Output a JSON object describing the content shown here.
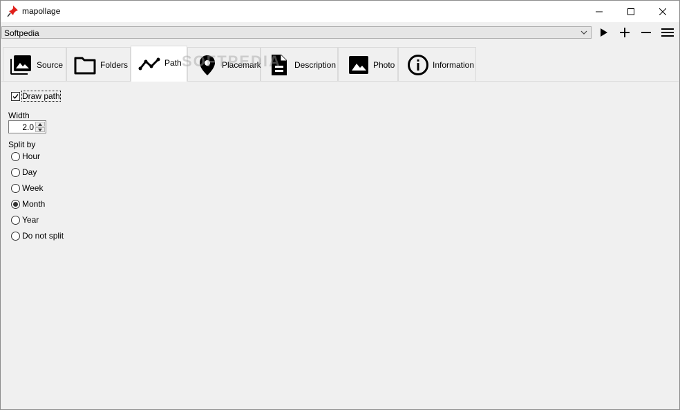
{
  "app": {
    "title": "mapollage"
  },
  "window_controls": {
    "minimize_icon": "minimize-icon",
    "maximize_icon": "maximize-icon",
    "close_icon": "close-icon"
  },
  "toolbar": {
    "profile_value": "Softpedia",
    "buttons": [
      "play-icon",
      "plus-icon",
      "minus-icon",
      "menu-icon"
    ]
  },
  "tabs": [
    {
      "label": "Source",
      "icon": "source-images-icon"
    },
    {
      "label": "Folders",
      "icon": "folder-icon"
    },
    {
      "label": "Path",
      "icon": "path-line-icon",
      "active": true
    },
    {
      "label": "Placemark",
      "icon": "map-pin-icon"
    },
    {
      "label": "Description",
      "icon": "document-icon"
    },
    {
      "label": "Photo",
      "icon": "photo-icon"
    },
    {
      "label": "Information",
      "icon": "info-icon"
    }
  ],
  "path_panel": {
    "draw_path_label": "Draw path",
    "draw_path_checked": true,
    "width_label": "Width",
    "width_value": "2.0",
    "split_by_label": "Split by",
    "split_options": [
      "Hour",
      "Day",
      "Week",
      "Month",
      "Year",
      "Do not split"
    ],
    "split_selected": "Month"
  },
  "watermark": "SOFTPEDIA",
  "colors": {
    "window_bg": "#f0f0f0",
    "active_tab_bg": "#ffffff",
    "app_icon_red": "#e0201b"
  }
}
